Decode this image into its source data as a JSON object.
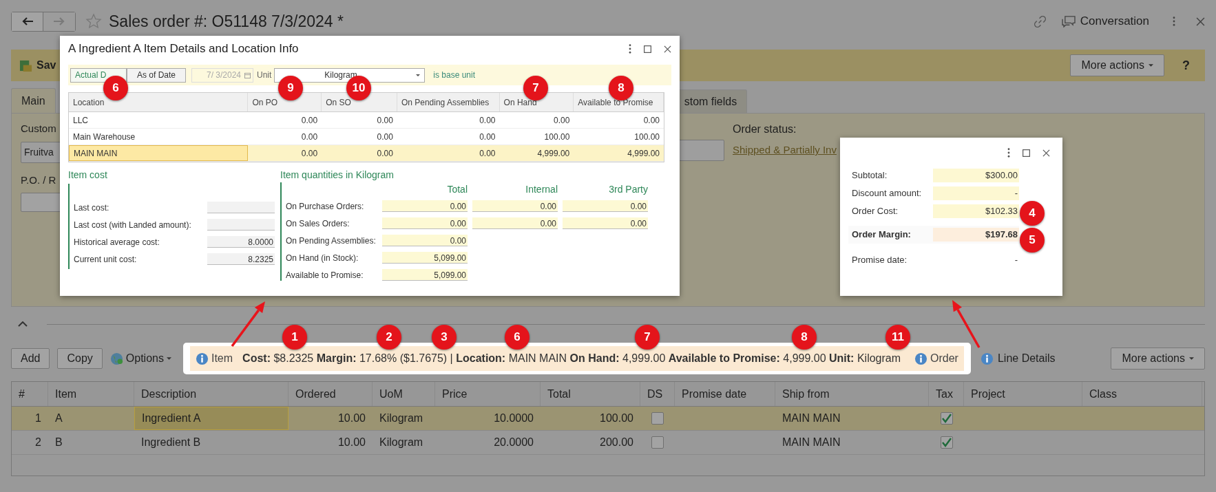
{
  "header": {
    "title": "Sales order #: O51148 7/3/2024 *",
    "conversation": "Conversation"
  },
  "toolbar": {
    "save": "Sav",
    "more_actions": "More actions",
    "help": "?"
  },
  "tabs": [
    {
      "label": "Main",
      "selected": true
    },
    {
      "label": "stom fields",
      "selected": false
    }
  ],
  "form": {
    "customer_label": "Custom",
    "customer_value": "Fruitva",
    "po_label": "P.O. / R",
    "order_status_label": "Order status:",
    "order_status_link": "Shipped & Partially Inv"
  },
  "details_popup": {
    "title": "A Ingredient A Item Details and Location Info",
    "date_buttons": [
      {
        "label": "Actual D",
        "selected": true
      },
      {
        "label": "As of Date",
        "selected": false
      }
    ],
    "date": "7/ 3/2024",
    "unit_label": "Unit",
    "unit_value": "Kilogram",
    "unit_note": "is base unit",
    "columns": [
      "Location",
      "On PO",
      "On SO",
      "On Pending Assemblies",
      "On Hand",
      "Available to Promise"
    ],
    "rows": [
      {
        "cells": [
          "LLC",
          "0.00",
          "0.00",
          "0.00",
          "0.00",
          "0.00"
        ],
        "selected": false
      },
      {
        "cells": [
          "Main Warehouse",
          "0.00",
          "0.00",
          "0.00",
          "100.00",
          "100.00"
        ],
        "selected": false
      },
      {
        "cells": [
          "MAIN MAIN",
          "0.00",
          "0.00",
          "0.00",
          "4,999.00",
          "4,999.00"
        ],
        "selected": true
      }
    ],
    "item_cost": {
      "title": "Item cost",
      "rows": [
        {
          "label": "Last cost:"
        },
        {
          "label": "Last cost (with Landed amount):"
        },
        {
          "label": "Historical average cost:",
          "value": "8.0000"
        },
        {
          "label": "Current unit cost:",
          "value": "8.2325"
        }
      ]
    },
    "quantities": {
      "title": "Item quantities in Kilogram",
      "columns": [
        "Total",
        "Internal",
        "3rd Party"
      ],
      "rows": [
        {
          "label": "On Purchase Orders:",
          "values": [
            "0.00",
            "0.00",
            "0.00"
          ]
        },
        {
          "label": "On Sales Orders:",
          "values": [
            "0.00",
            "0.00",
            "0.00"
          ]
        },
        {
          "label": "On Pending Assemblies:",
          "values": [
            "0.00"
          ]
        },
        {
          "label": "On Hand (in Stock):",
          "values": [
            "5,099.00"
          ]
        },
        {
          "label": "Available to Promise:",
          "values": [
            "5,099.00"
          ]
        }
      ]
    }
  },
  "order_popup": {
    "rows": [
      {
        "kind": "field",
        "label": "Subtotal:",
        "value": "$300.00"
      },
      {
        "kind": "field",
        "label": "Discount amount:",
        "value": "-"
      },
      {
        "kind": "field",
        "label": "Order Cost:",
        "value": "$102.33"
      },
      {
        "kind": "total",
        "label": "Order Margin:",
        "value": "$197.68"
      },
      {
        "kind": "plain",
        "label": "Promise date:",
        "value": "-"
      }
    ]
  },
  "lines_toolbar": {
    "buttons": [
      "Add",
      "Copy"
    ],
    "options": "Options",
    "item_link": "Item",
    "summary": "**Cost:** $8.2325 **Margin:** 17.68% ($1.7675) | **Location:** MAIN MAIN **On Hand:** 4,999.00 **Available to Promise:** 4,999.00 **Unit:** Kilogram",
    "order_link": "Order",
    "line_details": "Line Details",
    "more_actions": "More actions"
  },
  "grid": {
    "columns": [
      "#",
      "Item",
      "Description",
      "Ordered",
      "UoM",
      "Price",
      "Total",
      "DS",
      "Promise date",
      "Ship from",
      "Tax",
      "Project",
      "Class"
    ],
    "rows": [
      {
        "selected": true,
        "num": "1",
        "item": "A",
        "description": "Ingredient A",
        "ordered": "10.00",
        "uom": "Kilogram",
        "price": "10.0000",
        "total": "100.00",
        "ds": false,
        "ship_from": "MAIN MAIN",
        "tax": true
      },
      {
        "selected": false,
        "num": "2",
        "item": "B",
        "description": "Ingredient B",
        "ordered": "10.00",
        "uom": "Kilogram",
        "price": "20.0000",
        "total": "200.00",
        "ds": false,
        "ship_from": "MAIN MAIN",
        "tax": true
      }
    ]
  },
  "annotations": [
    {
      "label": "6"
    },
    {
      "label": "9"
    },
    {
      "label": "10"
    },
    {
      "label": "7"
    },
    {
      "label": "8"
    },
    {
      "label": "4"
    },
    {
      "label": "5"
    },
    {
      "label": "1"
    },
    {
      "label": "2"
    },
    {
      "label": "3"
    },
    {
      "label": "6"
    },
    {
      "label": "7"
    },
    {
      "label": "8"
    },
    {
      "label": "11"
    }
  ]
}
